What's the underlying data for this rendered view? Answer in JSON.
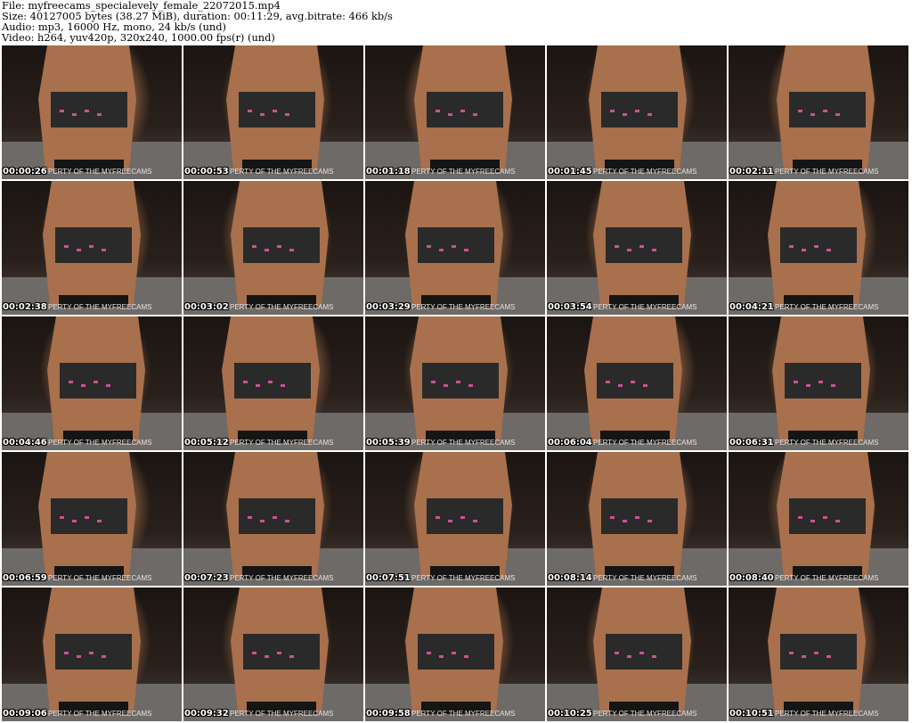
{
  "header": {
    "file": "File: myfreecams_specialevely_female_22072015.mp4",
    "size": "Size: 40127005 bytes (38.27 MiB), duration: 00:11:29, avg.bitrate: 466 kb/s",
    "audio": "Audio: mp3, 16000 Hz, mono, 24 kb/s (und)",
    "video": "Video: h264, yuv420p, 320x240, 1000.00 fps(r) (und)"
  },
  "watermark": "PERTY OF THE MYFREECAMS",
  "frames": [
    {
      "time": "00:00:26"
    },
    {
      "time": "00:00:53"
    },
    {
      "time": "00:01:18"
    },
    {
      "time": "00:01:45"
    },
    {
      "time": "00:02:11"
    },
    {
      "time": "00:02:38"
    },
    {
      "time": "00:03:02"
    },
    {
      "time": "00:03:29"
    },
    {
      "time": "00:03:54"
    },
    {
      "time": "00:04:21"
    },
    {
      "time": "00:04:46"
    },
    {
      "time": "00:05:12"
    },
    {
      "time": "00:05:39"
    },
    {
      "time": "00:06:04"
    },
    {
      "time": "00:06:31"
    },
    {
      "time": "00:06:59"
    },
    {
      "time": "00:07:23"
    },
    {
      "time": "00:07:51"
    },
    {
      "time": "00:08:14"
    },
    {
      "time": "00:08:40"
    },
    {
      "time": "00:09:06"
    },
    {
      "time": "00:09:32"
    },
    {
      "time": "00:09:58"
    },
    {
      "time": "00:10:25"
    },
    {
      "time": "00:10:51"
    }
  ]
}
